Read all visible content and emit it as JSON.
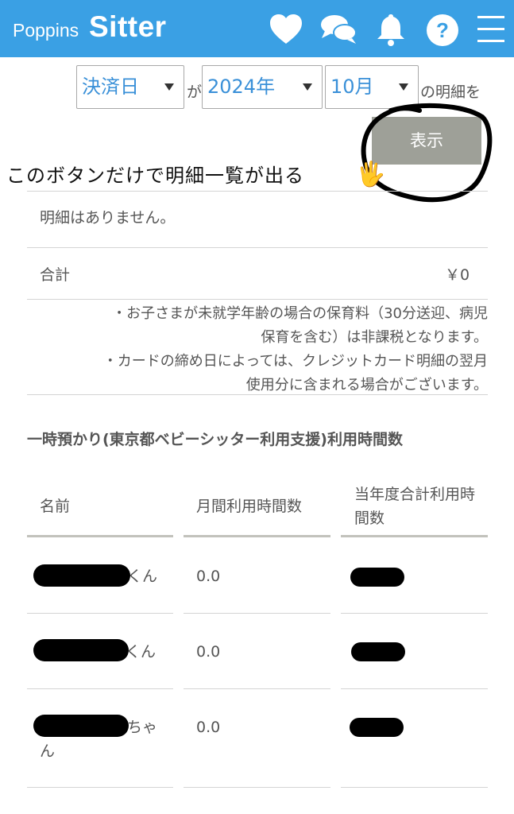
{
  "header": {
    "brand_small": "Poppins",
    "brand_big": "Sitter",
    "bg_color": "#3aa0e4",
    "icons": [
      "heart-icon",
      "chat-icon",
      "bell-icon",
      "help-icon",
      "menu-icon"
    ]
  },
  "filter": {
    "type_value": "決済日",
    "connector": "が",
    "year_value": "2024年",
    "month_value": "10月",
    "suffix": "の明細を",
    "show_button": "表示"
  },
  "annotation": {
    "text": "このボタンだけで明細一覧が出る",
    "emoji": "🖐"
  },
  "statement": {
    "empty_message": "明細はありません。",
    "total_label": "合計",
    "total_value": "￥0"
  },
  "notes": [
    [
      "・お子さまが未就学年齢の場合の保育料（30分送迎、病児",
      "保育を含む）は非課税となります。"
    ],
    [
      "・カードの締め日によっては、クレジットカード明細の翌月",
      "使用分に含まれる場合がございます。"
    ]
  ],
  "usage": {
    "title": "一時預かり(東京都ベビーシッター利用支援)利用時間数",
    "columns": [
      "名前",
      "月間利用時間数",
      "当年度合計利用時間数"
    ],
    "rows": [
      {
        "name_suffix": "くん",
        "monthly": "0.0"
      },
      {
        "name_suffix": "くん",
        "monthly": "0.0"
      },
      {
        "name_suffix": "ちゃん",
        "monthly": "0.0"
      }
    ]
  }
}
